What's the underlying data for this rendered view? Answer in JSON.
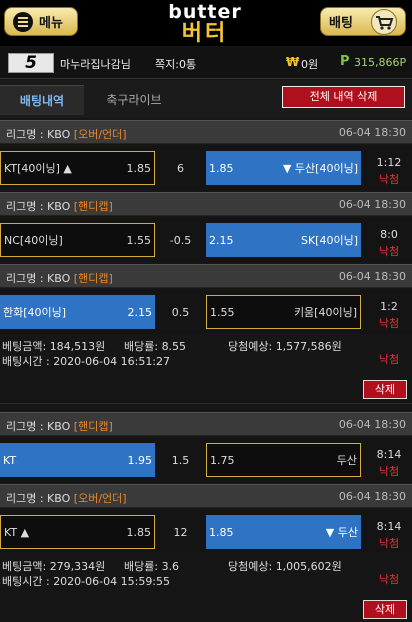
{
  "header": {
    "menu_label": "메뉴",
    "logo_en": "butter",
    "logo_ko": "버터",
    "bet_label": "배팅"
  },
  "user": {
    "level": "5",
    "name": "마누라집나감님",
    "notes": "쪽지:0통",
    "won_icon": "₩",
    "money": "0원",
    "points_icon": "P",
    "points": "315,866P"
  },
  "tabs": {
    "history": "배팅내역",
    "soccer_live": "축구라이브",
    "delete_all": "전체 내역 삭제"
  },
  "bets": [
    {
      "lines": [
        {
          "league": "리그명 : KBO",
          "type": "[오버/언더]",
          "time": "06-04 18:30",
          "left": "KT[40이닝] ▲",
          "left_odds": "1.85",
          "mid": "6",
          "right": "▼ 두산[40이닝]",
          "right_odds": "1.85",
          "score": "1:12",
          "result": "낙첨"
        },
        {
          "league": "리그명 : KBO",
          "type": "[핸디캡]",
          "time": "06-04 18:30",
          "left": "NC[40이닝]",
          "left_odds": "1.55",
          "mid": "-0.5",
          "right": "SK[40이닝]",
          "right_odds": "2.15",
          "score": "8:0",
          "result": "낙첨"
        },
        {
          "league": "리그명 : KBO",
          "type": "[핸디캡]",
          "time": "06-04 18:30",
          "left": "한화[40이닝]",
          "left_odds": "2.15",
          "mid": "0.5",
          "right": "키움[40이닝]",
          "right_odds": "1.55",
          "score": "1:2",
          "result": "낙첨"
        }
      ],
      "amount": "184,513원",
      "odds": "8.55",
      "expected_win": "1,577,586원",
      "bet_time": "2020-06-04 16:51:27",
      "result": "낙첨",
      "delete_label": "삭제"
    },
    {
      "lines": [
        {
          "league": "리그명 : KBO",
          "type": "[핸디캡]",
          "time": "06-04 18:30",
          "left": "KT",
          "left_odds": "1.95",
          "mid": "1.5",
          "right": "두산",
          "right_odds": "1.75",
          "score": "8:14",
          "result": "낙첨"
        },
        {
          "league": "리그명 : KBO",
          "type": "[오버/언더]",
          "time": "06-04 18:30",
          "left": "KT ▲",
          "left_odds": "1.85",
          "mid": "12",
          "right": "▼ 두산",
          "right_odds": "1.85",
          "score": "8:14",
          "result": "낙첨"
        }
      ],
      "amount": "279,334원",
      "odds": "3.6",
      "expected_win": "1,005,602원",
      "bet_time": "2020-06-04 15:59:55",
      "result": "낙첨",
      "delete_label": "삭제"
    }
  ],
  "labels": {
    "amount": "베팅금액: ",
    "odds": "배당률: ",
    "expected": "당첨예상: ",
    "time": "배팅시간 : "
  },
  "colors": {
    "accent_gold": "#d2ae3c",
    "selected_blue": "#2f73c4",
    "lose_red": "#e0343c",
    "delete_red": "#b00f1d"
  }
}
